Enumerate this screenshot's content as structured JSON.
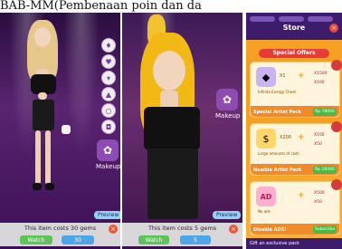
{
  "caption": "BAB-MM(Pembenaan poin dan da",
  "panel1": {
    "sidebar": {
      "buttons": [
        {
          "name": "dress",
          "glyph": "♦"
        },
        {
          "name": "heart",
          "glyph": "♥"
        },
        {
          "name": "shirt",
          "glyph": "▾"
        },
        {
          "name": "boot",
          "glyph": "▲"
        },
        {
          "name": "necklace",
          "glyph": "○"
        },
        {
          "name": "bag",
          "glyph": "◘"
        }
      ],
      "makeup_label": "Makeup",
      "makeup_glyph": "✿"
    },
    "preview_label": "Preview",
    "cost_text": "This item costs 30 gems",
    "watch_label": "Watch",
    "gems_label": "30"
  },
  "panel2": {
    "makeup_label": "Makeup",
    "preview_label": "Preview",
    "cost_text": "This item costs 5 gems",
    "watch_label": "Watch",
    "gems_label": "5"
  },
  "store": {
    "title": "Store",
    "special_offers": "Special Offers",
    "offers": [
      {
        "name": "Special Artist Pack",
        "price": "Rp 78000",
        "amount": "X1",
        "desc": "Infinite Energy Chest",
        "bonus1": "X1500",
        "bonus2": "X100",
        "color": "#c9b3f0",
        "glyph": "◆"
      },
      {
        "name": "Newbie Artist Pack",
        "price": "Rp 16000",
        "amount": "X200",
        "desc": "Large amounts of cash",
        "bonus1": "X100",
        "bonus2": "X50",
        "color": "#ffd66b",
        "glyph": "$"
      },
      {
        "name": "Disable ADS!",
        "price": "Subscribe",
        "amount": "",
        "desc": "No ads",
        "bonus1": "X500",
        "bonus2": "X50",
        "color": "#ffb0d0",
        "glyph": "AD"
      }
    ],
    "footer": "Gift an exclusive pack"
  }
}
